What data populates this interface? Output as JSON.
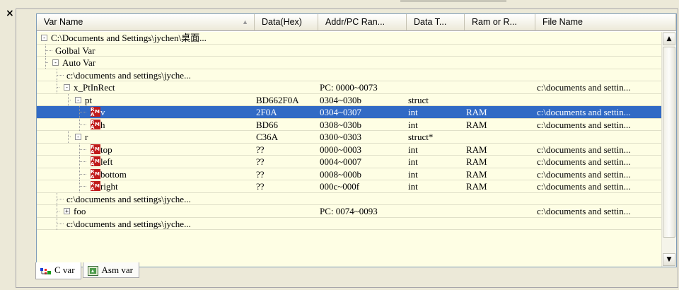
{
  "columns": [
    {
      "label": "Var Name",
      "width": 308,
      "sort": "▲"
    },
    {
      "label": "Data(Hex)",
      "width": 90
    },
    {
      "label": "Addr/PC Ran...",
      "width": 125
    },
    {
      "label": "Data T...",
      "width": 82
    },
    {
      "label": "Ram or R...",
      "width": 100
    },
    {
      "label": "File Name",
      "width": 199
    }
  ],
  "rows": [
    {
      "name": "C:\\Documents and Settings\\jychen\\桌面...",
      "level": 0,
      "toggle": "-",
      "icon": "",
      "data": "",
      "addr": "",
      "type": "",
      "ram": "",
      "file": ""
    },
    {
      "name": "Golbal Var",
      "level": 1,
      "toggle": "",
      "icon": "",
      "data": "",
      "addr": "",
      "type": "",
      "ram": "",
      "file": ""
    },
    {
      "name": "Auto Var",
      "level": 1,
      "toggle": "-",
      "icon": "",
      "data": "",
      "addr": "",
      "type": "",
      "ram": "",
      "file": ""
    },
    {
      "name": "c:\\documents and settings\\jyche...",
      "level": 2,
      "toggle": "",
      "icon": "",
      "data": "",
      "addr": "",
      "type": "",
      "ram": "",
      "file": ""
    },
    {
      "name": "x_PtInRect",
      "level": 2,
      "toggle": "-",
      "icon": "",
      "data": "",
      "addr": "PC: 0000~0073",
      "type": "",
      "ram": "",
      "file": "c:\\documents and settin..."
    },
    {
      "name": "pt",
      "level": 3,
      "toggle": "-",
      "icon": "",
      "data": "BD662F0A",
      "addr": "0304~030b",
      "type": "struct",
      "ram": "",
      "file": ""
    },
    {
      "name": "v",
      "level": 4,
      "toggle": "",
      "icon": "ram",
      "data": "2F0A",
      "addr": "0304~0307",
      "type": "int",
      "ram": "RAM",
      "file": "c:\\documents and settin...",
      "selected": true
    },
    {
      "name": "h",
      "level": 4,
      "toggle": "",
      "icon": "ram",
      "data": "BD66",
      "addr": "0308~030b",
      "type": "int",
      "ram": "RAM",
      "file": "c:\\documents and settin..."
    },
    {
      "name": "r",
      "level": 3,
      "toggle": "-",
      "icon": "",
      "data": "C36A",
      "addr": "0300~0303",
      "type": "struct*",
      "ram": "",
      "file": ""
    },
    {
      "name": "top",
      "level": 4,
      "toggle": "",
      "icon": "ram",
      "data": "??",
      "addr": "0000~0003",
      "type": "int",
      "ram": "RAM",
      "file": "c:\\documents and settin..."
    },
    {
      "name": "left",
      "level": 4,
      "toggle": "",
      "icon": "ram",
      "data": "??",
      "addr": "0004~0007",
      "type": "int",
      "ram": "RAM",
      "file": "c:\\documents and settin..."
    },
    {
      "name": "bottom",
      "level": 4,
      "toggle": "",
      "icon": "ram",
      "data": "??",
      "addr": "0008~000b",
      "type": "int",
      "ram": "RAM",
      "file": "c:\\documents and settin..."
    },
    {
      "name": "right",
      "level": 4,
      "toggle": "",
      "icon": "ram",
      "data": "??",
      "addr": "000c~000f",
      "type": "int",
      "ram": "RAM",
      "file": "c:\\documents and settin..."
    },
    {
      "name": "c:\\documents and settings\\jyche...",
      "level": 2,
      "toggle": "",
      "icon": "",
      "data": "",
      "addr": "",
      "type": "",
      "ram": "",
      "file": ""
    },
    {
      "name": "foo",
      "level": 2,
      "toggle": "+",
      "icon": "",
      "data": "",
      "addr": "PC: 0074~0093",
      "type": "",
      "ram": "",
      "file": "c:\\documents and settin..."
    },
    {
      "name": "c:\\documents and settings\\jyche...",
      "level": 2,
      "toggle": "",
      "icon": "",
      "data": "",
      "addr": "",
      "type": "",
      "ram": "",
      "file": ""
    }
  ],
  "ram_icon_text": {
    "r": "R",
    "a": "A",
    "m": "M"
  },
  "tabs": [
    {
      "label": "C var",
      "icon": "c-var-icon",
      "active": true
    },
    {
      "label": "Asm var",
      "icon": "asm-var-icon",
      "active": false
    }
  ],
  "close_label": "×",
  "scroll": {
    "up": "▲",
    "down": "▼"
  },
  "colors": {
    "selection": "#316ac5",
    "row_bg": "#fefee4",
    "ram_icon": "#c01c1c"
  }
}
